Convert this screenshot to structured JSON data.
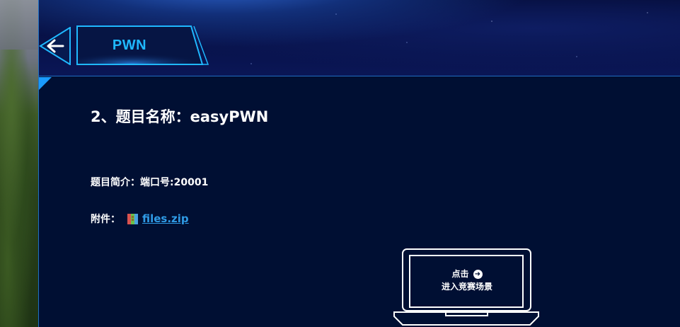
{
  "header": {
    "category_title": "PWN",
    "back_icon": "back-arrow-icon"
  },
  "challenge": {
    "title": "2、题目名称：easyPWN",
    "description_label": "题目简介：",
    "description_value": "端口号:20001",
    "attachment_label": "附件：",
    "attachment_icon": "zip-file-icon",
    "attachment_name": "files.zip"
  },
  "enter_scene": {
    "line1": "点击",
    "line2": "进入竞赛场景",
    "icon": "circle-arrow-right-icon"
  },
  "colors": {
    "accent": "#1fb8ff",
    "link": "#2f9be6",
    "panel_bg": "#000f33"
  }
}
